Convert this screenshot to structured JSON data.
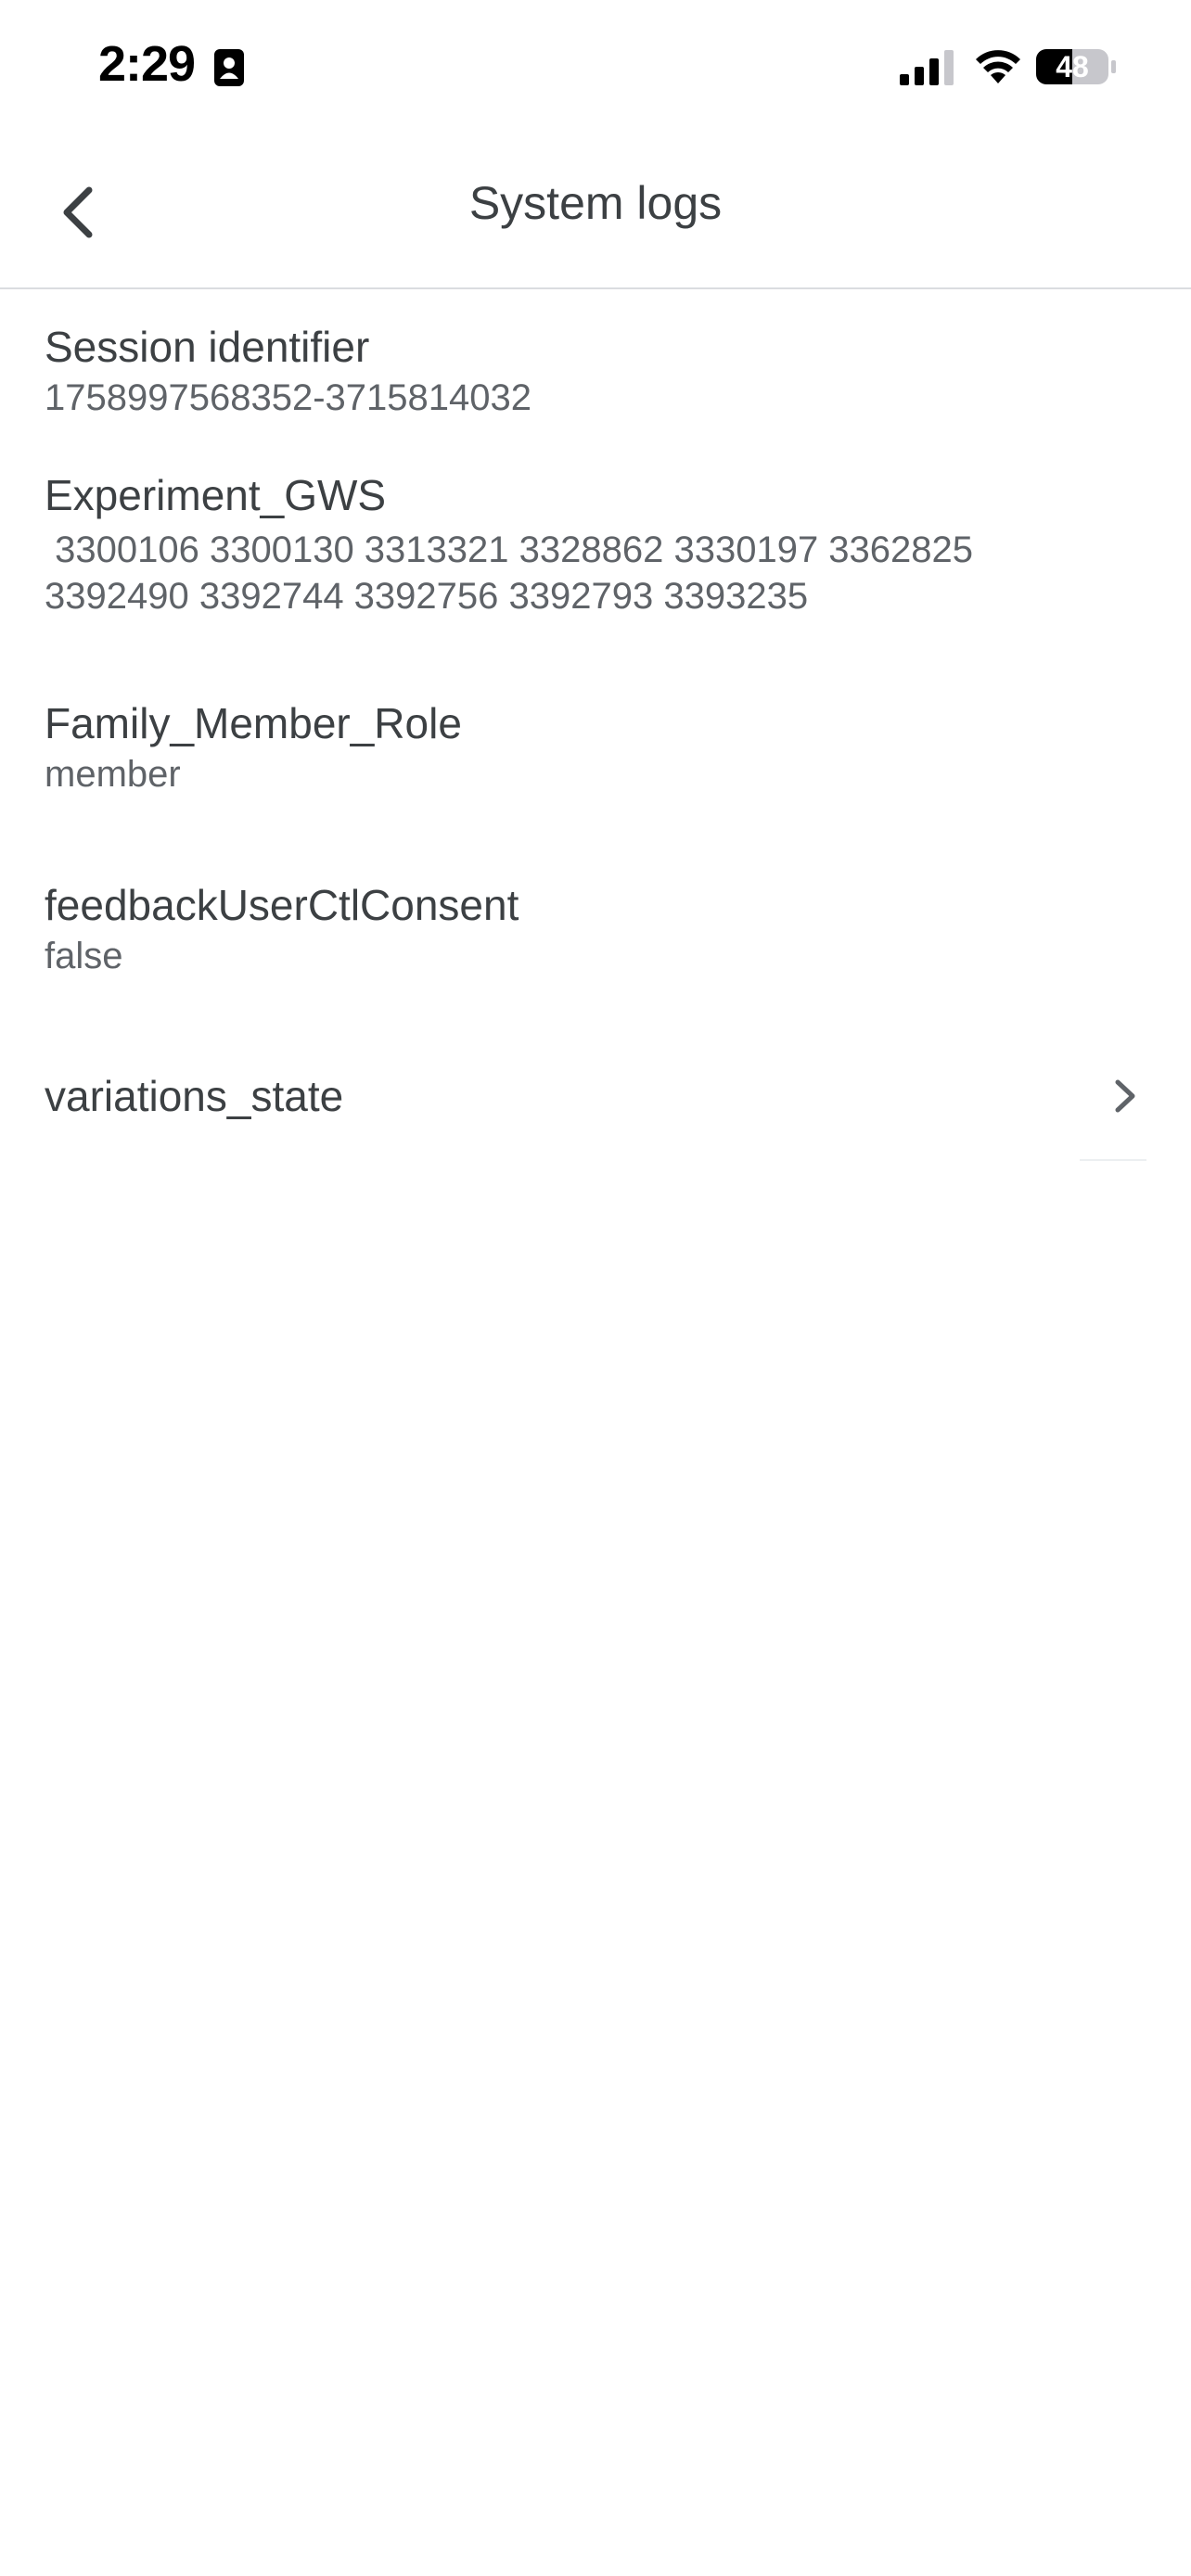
{
  "status_bar": {
    "time": "2:29",
    "battery": "48",
    "icons": [
      "contact-card-icon",
      "signal-icon",
      "wifi-icon",
      "battery-icon"
    ]
  },
  "app_bar": {
    "title": "System logs",
    "back_icon": "chevron-left-icon"
  },
  "items": [
    {
      "key": "Session identifier",
      "value": "1758997568352-3715814032"
    },
    {
      "key": "Experiment_GWS",
      "value": " 3300106 3300130 3313321 3328862 3330197 3362825\n3392490 3392744 3392756 3392793 3393235"
    },
    {
      "key": "Family_Member_Role",
      "value": "member"
    },
    {
      "key": "feedbackUserCtlConsent",
      "value": "false"
    },
    {
      "key": "variations_state",
      "chevron": "chevron-right-icon"
    }
  ],
  "colors": {
    "text_primary": "#3c4043",
    "text_secondary": "#5f6368",
    "divider": "#dadce0",
    "background": "#ffffff"
  }
}
